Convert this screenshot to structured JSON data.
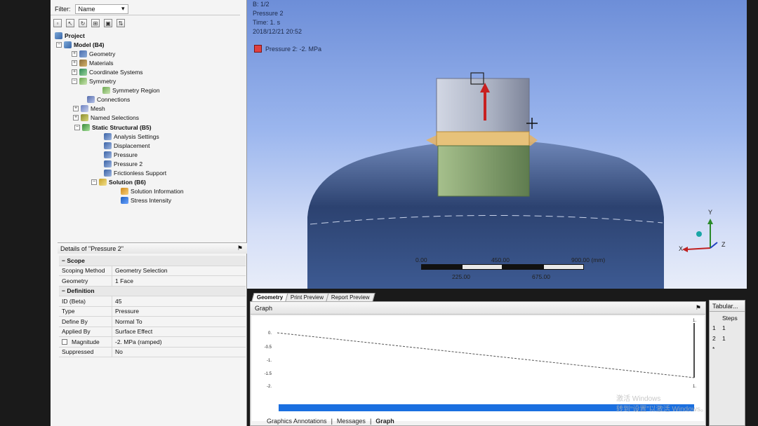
{
  "outline": {
    "filter_label": "Filter:",
    "filter_value": "Name",
    "items": [
      {
        "label": "Project"
      },
      {
        "label": "Model (B4)"
      },
      {
        "label": "Geometry"
      },
      {
        "label": "Materials"
      },
      {
        "label": "Coordinate Systems"
      },
      {
        "label": "Symmetry"
      },
      {
        "label": "Symmetry Region"
      },
      {
        "label": "Connections"
      },
      {
        "label": "Mesh"
      },
      {
        "label": "Named Selections"
      },
      {
        "label": "Static Structural (B5)"
      },
      {
        "label": "Analysis Settings"
      },
      {
        "label": "Displacement"
      },
      {
        "label": "Pressure"
      },
      {
        "label": "Pressure 2"
      },
      {
        "label": "Frictionless Support"
      },
      {
        "label": "Solution (B6)"
      },
      {
        "label": "Solution Information"
      },
      {
        "label": "Stress Intensity"
      }
    ]
  },
  "details": {
    "title": "Details of \"Pressure 2\"",
    "pin": "⚑",
    "rows": [
      {
        "k": "Scope",
        "v": ""
      },
      {
        "k": "Scoping Method",
        "v": "Geometry Selection"
      },
      {
        "k": "Geometry",
        "v": "1 Face"
      },
      {
        "k": "Definition",
        "v": ""
      },
      {
        "k": "ID (Beta)",
        "v": "45"
      },
      {
        "k": "Type",
        "v": "Pressure"
      },
      {
        "k": "Define By",
        "v": "Normal To"
      },
      {
        "k": "Applied By",
        "v": "Surface Effect"
      },
      {
        "k": "Magnitude",
        "v": "-2. MPa  (ramped)"
      },
      {
        "k": "Suppressed",
        "v": "No"
      }
    ]
  },
  "viewport": {
    "header_line1": "B: 1/2",
    "header_line2": "Pressure 2",
    "header_line3": "Time: 1. s",
    "header_line4": "2018/12/21 20:52",
    "legend_label": "Pressure 2: -2. MPa",
    "legend_color": "#e04040",
    "scale": {
      "t0": "0.00",
      "t450": "450.00",
      "t900": "900.00 (mm)",
      "t225": "225.00",
      "t675": "675.00"
    },
    "axis_y": "Y",
    "axis_x": "X",
    "axis_z": "Z"
  },
  "view_tabs": [
    "Geometry",
    "Print Preview",
    "Report Preview"
  ],
  "graph": {
    "title": "Graph",
    "pin": "⚑",
    "y_ticks": [
      "0.",
      "-0.5",
      "-1.",
      "-1.5",
      "-2."
    ],
    "x_end_top": "1.",
    "x_end_bottom": "1."
  },
  "bottom_tabs": [
    "Graphics Annotations",
    "Messages",
    "Graph"
  ],
  "tabular": {
    "title": "Tabular...",
    "header": "Steps",
    "rows": [
      {
        "n": "1",
        "v": "1"
      },
      {
        "n": "2",
        "v": "1"
      },
      {
        "n": "*",
        "v": ""
      }
    ]
  },
  "watermark": "激活 Windows\n转到“设置”以激活 Windows。",
  "chart_data": {
    "type": "line",
    "title": "",
    "xlabel": "",
    "ylabel": "",
    "series": [
      {
        "x": [
          0,
          1
        ],
        "y": [
          0,
          -2
        ]
      }
    ],
    "ylim": [
      -2,
      0
    ],
    "xlim": [
      0,
      1
    ]
  }
}
